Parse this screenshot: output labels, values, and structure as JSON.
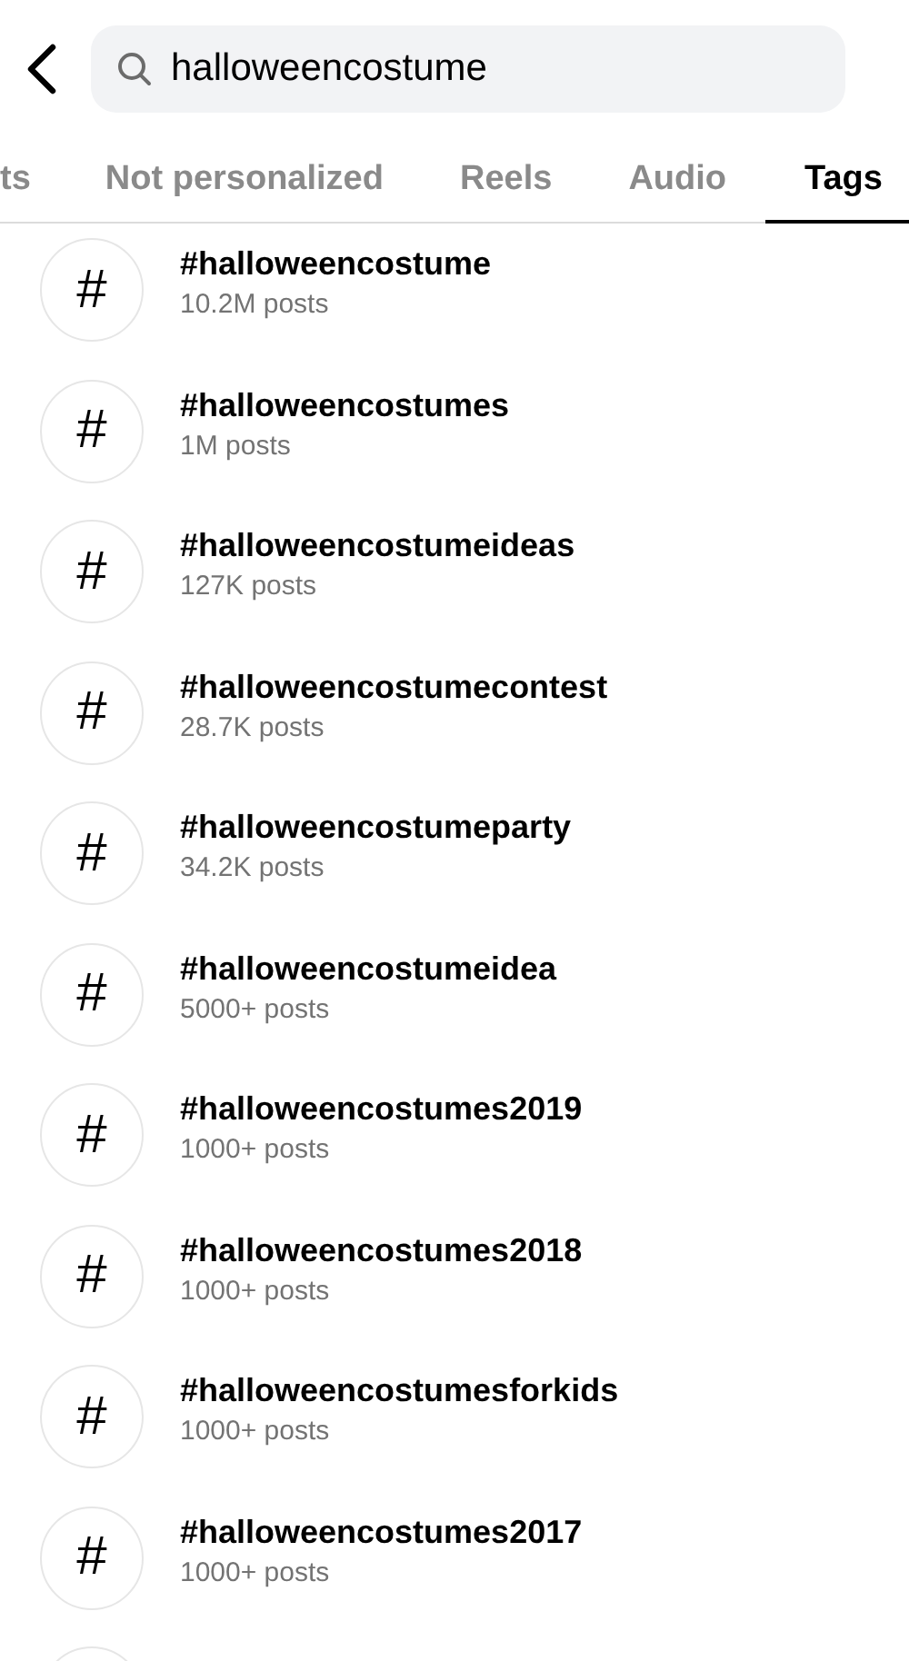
{
  "search": {
    "value": "halloweencostume"
  },
  "tabs": [
    {
      "label": "ts",
      "selected": false
    },
    {
      "label": "Not personalized",
      "selected": false
    },
    {
      "label": "Reels",
      "selected": false
    },
    {
      "label": "Audio",
      "selected": false
    },
    {
      "label": "Tags",
      "selected": true
    }
  ],
  "results": [
    {
      "icon": "#",
      "tag": "#halloweencostume",
      "posts": "10.2M posts"
    },
    {
      "icon": "#",
      "tag": "#halloweencostumes",
      "posts": "1M posts"
    },
    {
      "icon": "#",
      "tag": "#halloweencostumeideas",
      "posts": "127K posts"
    },
    {
      "icon": "#",
      "tag": "#halloweencostumecontest",
      "posts": "28.7K posts"
    },
    {
      "icon": "#",
      "tag": "#halloweencostumeparty",
      "posts": "34.2K posts"
    },
    {
      "icon": "#",
      "tag": "#halloweencostumeidea",
      "posts": "5000+ posts"
    },
    {
      "icon": "#",
      "tag": "#halloweencostumes2019",
      "posts": "1000+ posts"
    },
    {
      "icon": "#",
      "tag": "#halloweencostumes2018",
      "posts": "1000+ posts"
    },
    {
      "icon": "#",
      "tag": "#halloweencostumesforkids",
      "posts": "1000+ posts"
    },
    {
      "icon": "#",
      "tag": "#halloweencostumes2017",
      "posts": "1000+ posts"
    }
  ]
}
